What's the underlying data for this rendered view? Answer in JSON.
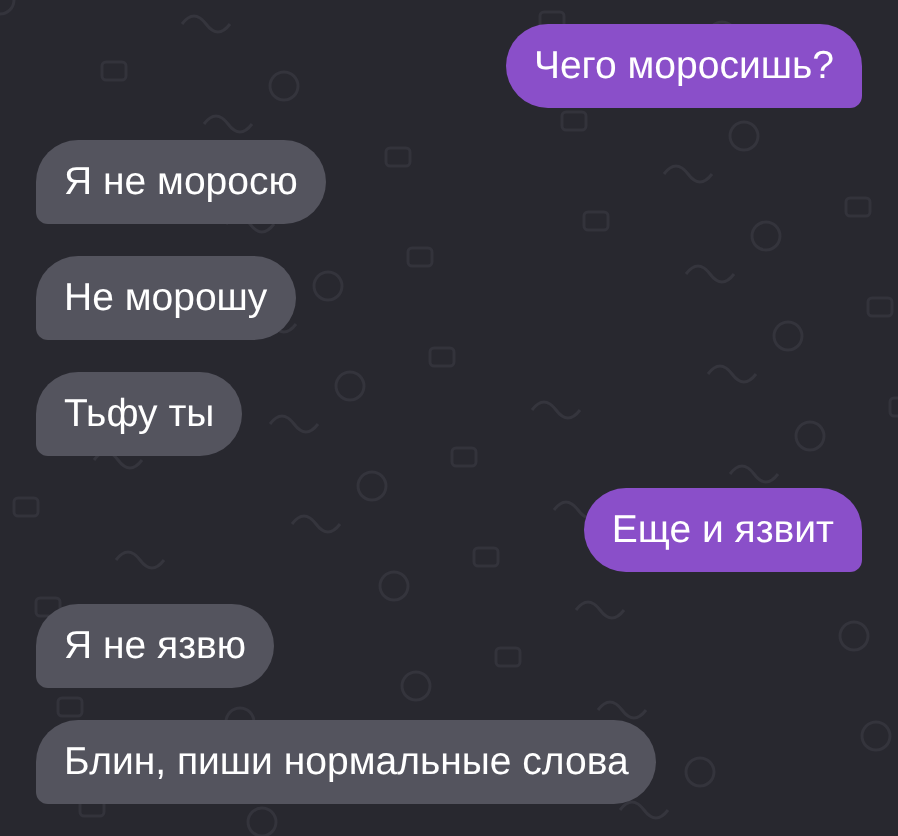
{
  "messages": [
    {
      "text": "Чего моросишь?",
      "kind": "outgoing"
    },
    {
      "text": "Я не моросю",
      "kind": "incoming"
    },
    {
      "text": "Не морошу",
      "kind": "incoming"
    },
    {
      "text": "Тьфу ты",
      "kind": "incoming"
    },
    {
      "text": "Еще и язвит",
      "kind": "outgoing"
    },
    {
      "text": "Я не язвю",
      "kind": "incoming"
    },
    {
      "text": "Блин, пиши нормальные слова",
      "kind": "incoming"
    }
  ]
}
